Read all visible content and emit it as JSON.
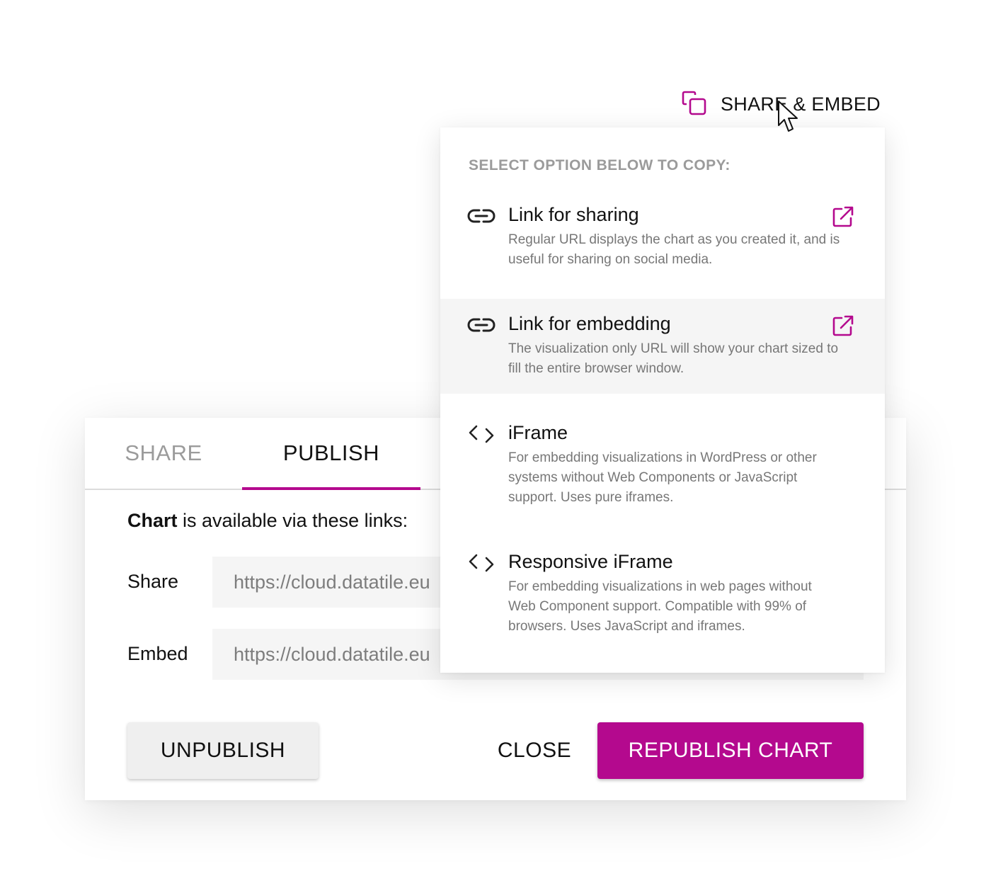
{
  "share_embed": {
    "label": "SHARE & EMBED",
    "menu_header": "SELECT OPTION BELOW TO COPY:",
    "items": [
      {
        "title": "Link for sharing",
        "description": "Regular URL displays the chart as you created it, and is useful for sharing on social media.",
        "icon": "link-icon",
        "external_icon": "external-link-icon"
      },
      {
        "title": "Link for embedding",
        "description": "The visualization only URL will show your chart sized to fill the entire browser window.",
        "icon": "link-icon",
        "external_icon": "external-link-icon"
      },
      {
        "title": "iFrame",
        "description": "For embedding visualizations in WordPress or other systems without Web Components or JavaScript support. Uses pure iframes.",
        "icon": "code-icon"
      },
      {
        "title": "Responsive iFrame",
        "description": "For embedding visualizations in web pages without Web Component support. Compatible with 99% of browsers. Uses JavaScript and iframes.",
        "icon": "code-icon"
      }
    ]
  },
  "dialog": {
    "tabs": [
      {
        "label": "SHARE",
        "active": false
      },
      {
        "label": "PUBLISH",
        "active": true
      }
    ],
    "intro_bold": "Chart",
    "intro_rest": " is available via these links:",
    "fields": [
      {
        "label": "Share",
        "value": "https://cloud.datatile.eu"
      },
      {
        "label": "Embed",
        "value": "https://cloud.datatile.eu"
      }
    ],
    "buttons": {
      "unpublish": "UNPUBLISH",
      "close": "CLOSE",
      "republish": "REPUBLISH CHART"
    }
  },
  "colors": {
    "accent": "#b4098e",
    "hover_row": "#f5f5f5",
    "field_bg": "#f5f5f5",
    "muted_text": "#9b9b9b"
  }
}
